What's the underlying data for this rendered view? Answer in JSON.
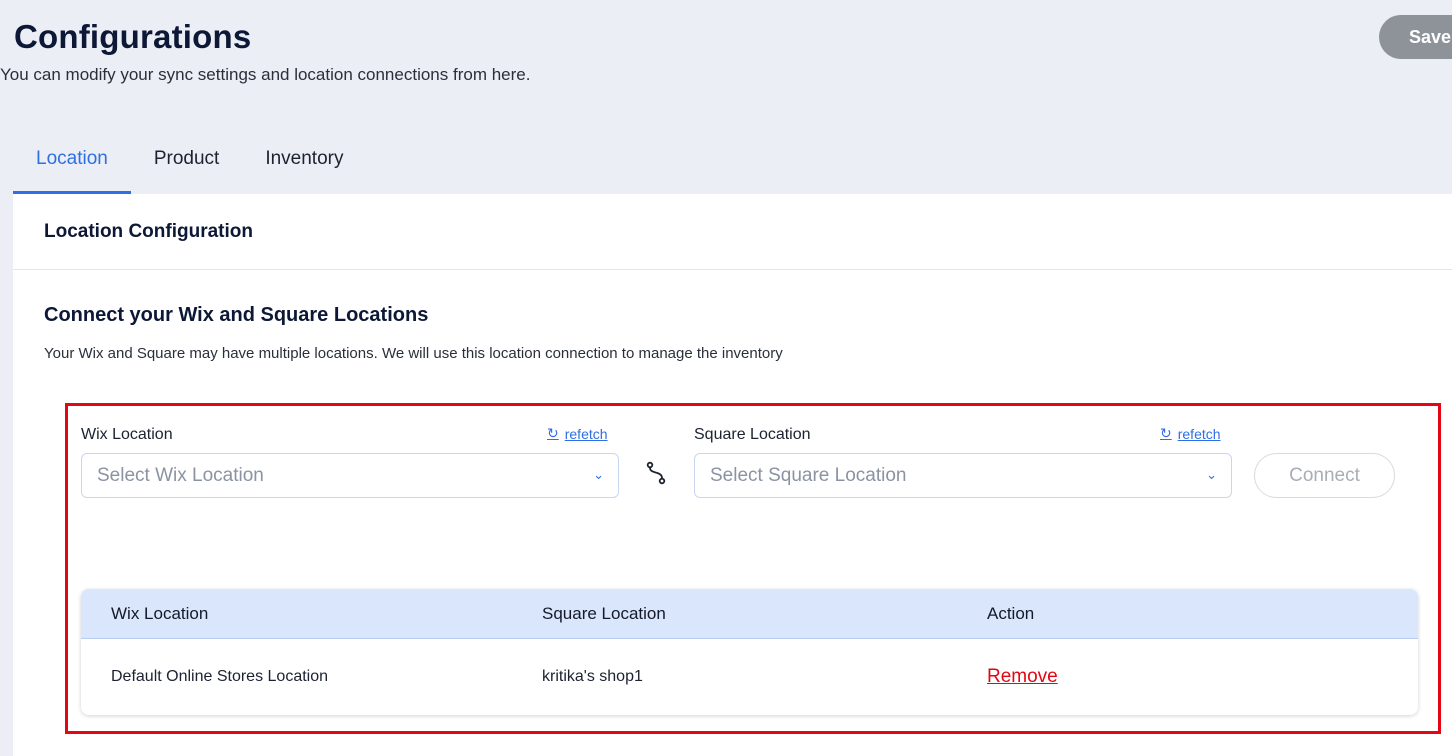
{
  "header": {
    "title": "Configurations",
    "subtitle": "You can modify your sync settings and location connections from here.",
    "save_label": "Save"
  },
  "tabs": [
    {
      "label": "Location",
      "active": true
    },
    {
      "label": "Product",
      "active": false
    },
    {
      "label": "Inventory",
      "active": false
    }
  ],
  "panel": {
    "title": "Location Configuration",
    "section_title": "Connect your Wix and Square Locations",
    "section_desc": "Your Wix and Square may have multiple locations. We will use this location connection to manage the inventory"
  },
  "connector": {
    "wix_label": "Wix Location",
    "wix_placeholder": "Select Wix Location",
    "square_label": "Square Location",
    "square_placeholder": "Select Square Location",
    "refetch_label": "refetch",
    "connect_label": "Connect"
  },
  "table": {
    "headers": [
      "Wix Location",
      "Square Location",
      "Action"
    ],
    "rows": [
      {
        "wix": "Default Online Stores Location",
        "square": "kritika's shop1",
        "action": "Remove"
      }
    ]
  },
  "colors": {
    "accent": "#2f6fe4",
    "highlight": "#e30613",
    "background": "#ebeef4"
  },
  "icons": {
    "refetch": "refresh-icon",
    "link": "link-icon",
    "dropdown": "chevron-down-icon"
  }
}
